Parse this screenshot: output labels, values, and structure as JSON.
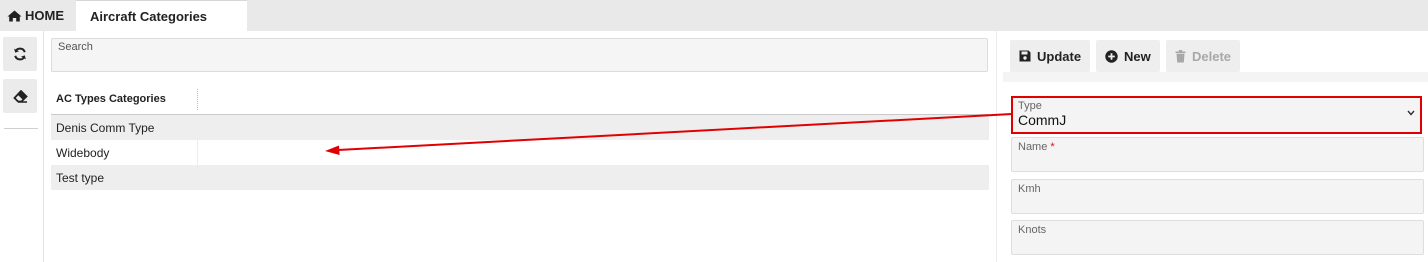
{
  "tabs": {
    "home_label": "HOME",
    "active_label": "Aircraft Categories"
  },
  "left_rail": {
    "refresh_icon": "refresh-icon",
    "eraser_icon": "eraser-icon"
  },
  "search": {
    "label": "Search"
  },
  "grid": {
    "column_header": "AC Types Categories",
    "rows": [
      "Denis Comm Type",
      "Widebody",
      "Test type"
    ]
  },
  "toolbar": {
    "update_label": "Update",
    "new_label": "New",
    "delete_label": "Delete"
  },
  "form": {
    "type_label": "Type",
    "type_value": "CommJ",
    "name_label": "Name",
    "name_required_mark": "*",
    "kmh_label": "Kmh",
    "knots_label": "Knots"
  },
  "colors": {
    "annotation_red": "#e00000",
    "disabled_text": "#a8a8a8"
  }
}
